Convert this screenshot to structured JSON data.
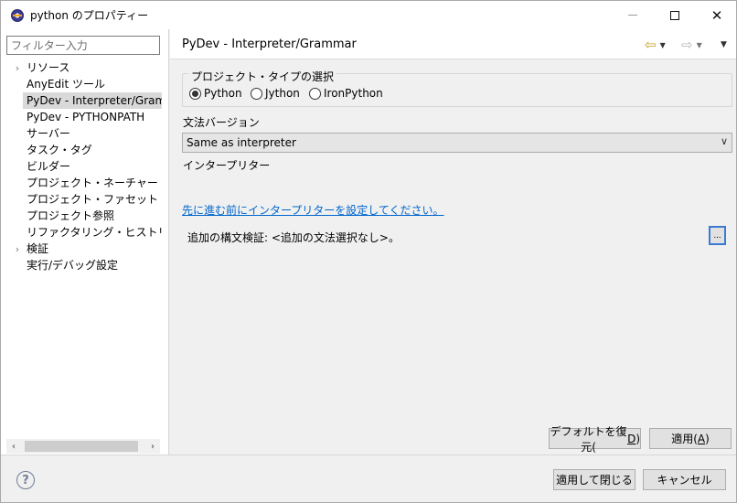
{
  "window": {
    "title": "python のプロパティー",
    "minimize_symbol": "—",
    "close_symbol": "✕"
  },
  "sidebar": {
    "filter_placeholder": "フィルター入力",
    "items": [
      {
        "label": "リソース",
        "expandable": true
      },
      {
        "label": "AnyEdit ツール",
        "expandable": false
      },
      {
        "label": "PyDev - Interpreter/Grammar",
        "expandable": false,
        "selected": true
      },
      {
        "label": "PyDev - PYTHONPATH",
        "expandable": false
      },
      {
        "label": "サーバー",
        "expandable": false
      },
      {
        "label": "タスク・タグ",
        "expandable": false
      },
      {
        "label": "ビルダー",
        "expandable": false
      },
      {
        "label": "プロジェクト・ネーチャー",
        "expandable": false
      },
      {
        "label": "プロジェクト・ファセット",
        "expandable": false
      },
      {
        "label": "プロジェクト参照",
        "expandable": false
      },
      {
        "label": "リファクタリング・ヒストリー",
        "expandable": false
      },
      {
        "label": "検証",
        "expandable": true
      },
      {
        "label": "実行/デバッグ設定",
        "expandable": false
      }
    ]
  },
  "page": {
    "title": "PyDev - Interpreter/Grammar",
    "project_type": {
      "legend": "プロジェクト・タイプの選択",
      "options": [
        "Python",
        "Jython",
        "IronPython"
      ],
      "selected": "Python"
    },
    "grammar_label": "文法バージョン",
    "grammar_value": "Same as interpreter",
    "interpreter_label": "インタープリター",
    "configure_link": "先に進む前にインタープリターを設定してください。",
    "extra_syntax_label": "追加の構文検証: <追加の文法選択なし>。",
    "dots_button": "...",
    "restore_defaults": {
      "text": "デフォルトを復元(",
      "mnemonic": "D",
      "suffix": ")"
    },
    "apply": {
      "text": "適用(",
      "mnemonic": "A",
      "suffix": ")"
    }
  },
  "footer": {
    "help_symbol": "?",
    "apply_and_close": "適用して閉じる",
    "cancel": "キャンセル"
  },
  "colors": {
    "link": "#0066cc",
    "back_arrow": "#c7a020",
    "focus_border": "#3c7bd1"
  }
}
